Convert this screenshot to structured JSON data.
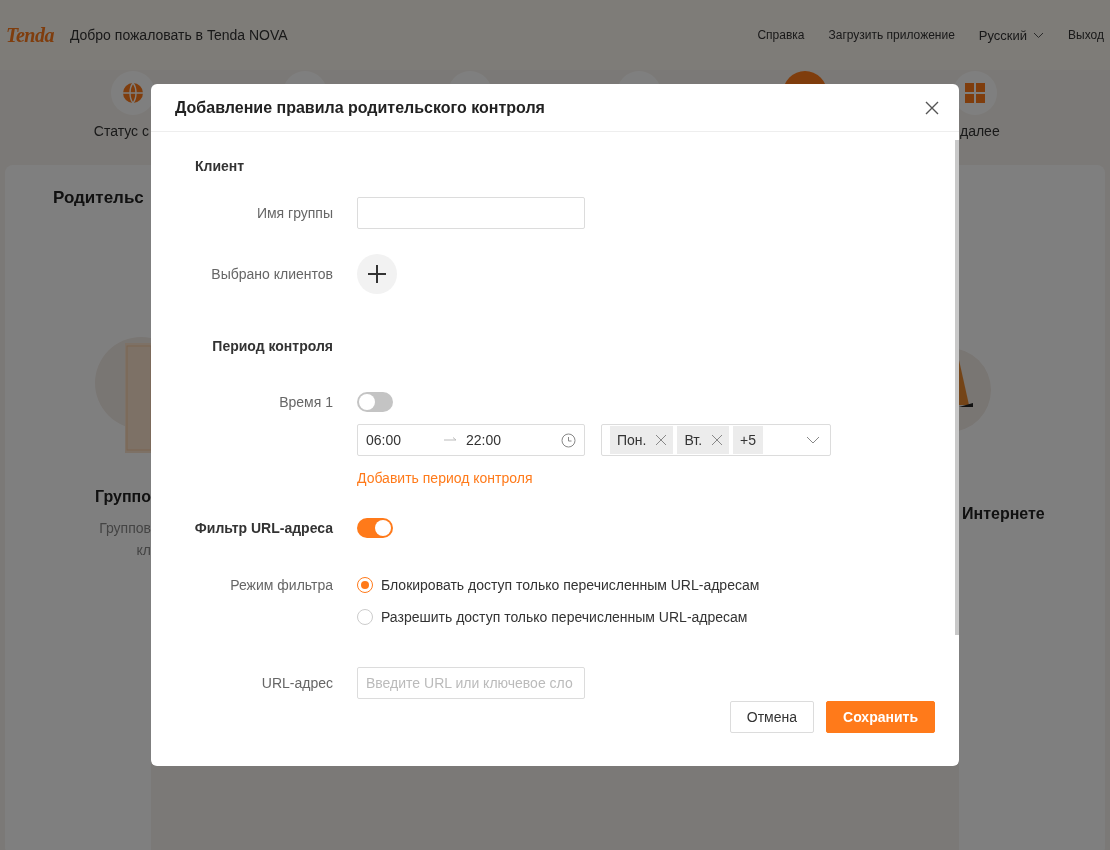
{
  "header": {
    "logo": "Tenda",
    "welcome": "Добро пожаловать в Tenda NOVA",
    "links": [
      "Справка",
      "Загрузить приложение"
    ],
    "language": "Русский",
    "logout": "Выход"
  },
  "nav_items": [
    {
      "label": "Статус с",
      "selected": false
    },
    {
      "selected": false
    },
    {
      "selected": false
    },
    {
      "selected": false
    },
    {
      "selected": true
    },
    {
      "label": "далее",
      "selected": false
    }
  ],
  "card": {
    "title": "Родительс",
    "left_feature": {
      "title": "Группо",
      "description": [
        "Группов",
        "кл"
      ]
    },
    "right_feature": {
      "title": "Интернете"
    }
  },
  "dialog": {
    "title": "Добавление правила родительского контроля",
    "client_section": "Клиент",
    "group_name": {
      "label": "Имя группы"
    },
    "clients": {
      "label": "Выбрано клиентов"
    },
    "period_section": "Период контроля",
    "times": [
      {
        "label": "Время 1",
        "on": false,
        "start": "06:00",
        "end": "22:00",
        "days": [
          "Пон.",
          "Вт."
        ],
        "more_days": "+5"
      }
    ],
    "add_period": "Добавить период контроля",
    "url_filter": {
      "label": "Фильтр URL-адреса",
      "on": true
    },
    "filter_mode": {
      "label": "Режим фильтра",
      "options": [
        {
          "label": "Блокировать доступ только перечисленным URL-адресам",
          "selected": true
        },
        {
          "label": "Разрешить доступ только перечисленным URL-адресам",
          "selected": false
        }
      ]
    },
    "url": {
      "label": "URL-адрес",
      "placeholder": "Введите URL или ключевое сло"
    },
    "buttons": [
      {
        "label": "Отмена",
        "kind": "secondary"
      },
      {
        "label": "Сохранить",
        "kind": "primary"
      }
    ]
  }
}
